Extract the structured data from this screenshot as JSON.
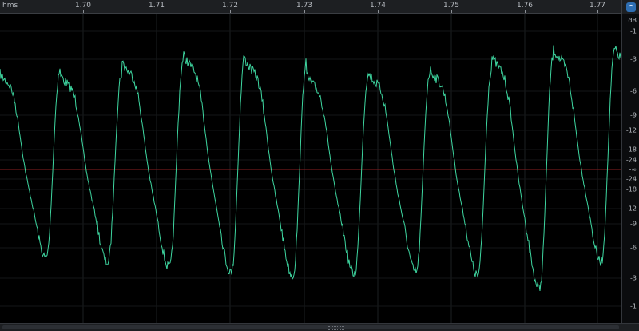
{
  "ruler": {
    "unit": "hms",
    "ticks": [
      "1.70",
      "1.71",
      "1.72",
      "1.73",
      "1.74",
      "1.75",
      "1.76",
      "1.77"
    ]
  },
  "toolbar": {
    "snap_icon": "magnet-icon",
    "accent": "#2f6fb3"
  },
  "db_scale": {
    "unit": "dB",
    "labels": [
      "-1",
      "-3",
      "-6",
      "-9",
      "-12",
      "-18",
      "-24",
      "-∞",
      "-24",
      "-18",
      "-12",
      "-9",
      "-6",
      "-3",
      "-1"
    ]
  },
  "waveform": {
    "color": "#3ed6a0",
    "centerline_color": "#8b1f22",
    "cycles": 10,
    "time_start": 1.6955,
    "time_end": 1.7725
  }
}
